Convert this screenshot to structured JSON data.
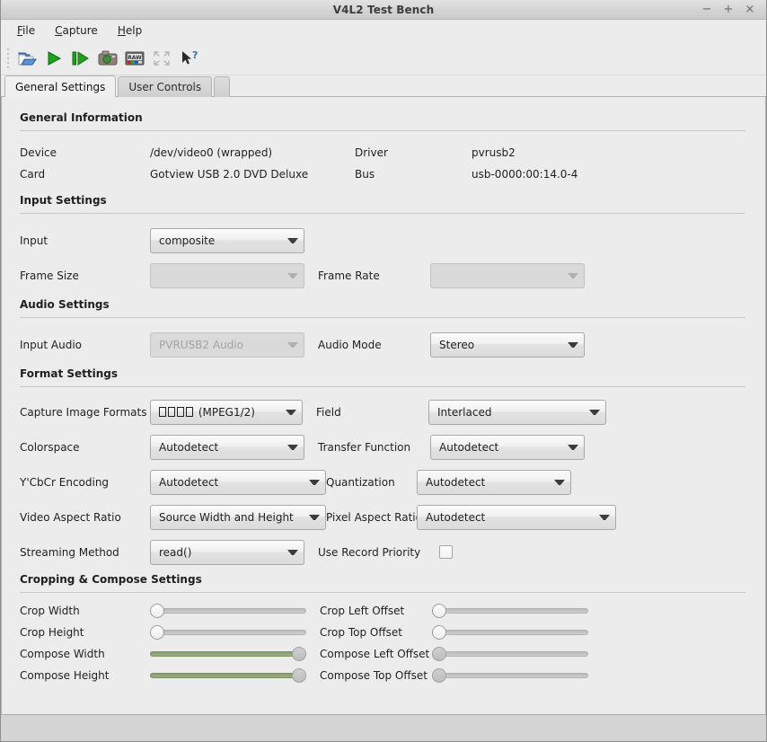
{
  "window": {
    "title": "V4L2 Test Bench",
    "buttons": {
      "minimize": "−",
      "maximize": "+",
      "close": "×"
    }
  },
  "menubar": {
    "items": [
      {
        "label": "File",
        "mnemonic": "F"
      },
      {
        "label": "Capture",
        "mnemonic": "C"
      },
      {
        "label": "Help",
        "mnemonic": "H"
      }
    ]
  },
  "toolbar": {
    "items": [
      {
        "name": "open-file-icon",
        "title": "Open"
      },
      {
        "name": "play-icon",
        "title": "Start Capture"
      },
      {
        "name": "play-step-icon",
        "title": "Step"
      },
      {
        "name": "snapshot-camera-icon",
        "title": "Snapshot"
      },
      {
        "name": "raw-capture-icon",
        "title": "Raw Capture"
      },
      {
        "name": "fullscreen-icon",
        "title": "Fullscreen"
      },
      {
        "name": "whats-this-help-icon",
        "title": "What's This?"
      }
    ]
  },
  "tabs": [
    {
      "label": "General Settings",
      "active": true
    },
    {
      "label": "User Controls",
      "active": false
    },
    {
      "label": "",
      "active": false
    }
  ],
  "sections": {
    "general_information": {
      "title": "General Information",
      "fields": [
        {
          "label": "Device",
          "value": "/dev/video0 (wrapped)",
          "label2": "Driver",
          "value2": "pvrusb2"
        },
        {
          "label": "Card",
          "value": "Gotview USB 2.0 DVD Deluxe",
          "label2": "Bus",
          "value2": "usb-0000:00:14.0-4"
        }
      ]
    },
    "input_settings": {
      "title": "Input Settings",
      "input": {
        "label": "Input",
        "value": "composite",
        "disabled": false
      },
      "frame_size": {
        "label": "Frame Size",
        "value": "",
        "disabled": true
      },
      "frame_rate": {
        "label": "Frame Rate",
        "value": "",
        "disabled": true
      }
    },
    "audio_settings": {
      "title": "Audio Settings",
      "input_audio": {
        "label": "Input Audio",
        "value": "PVRUSB2 Audio",
        "disabled": true
      },
      "audio_mode": {
        "label": "Audio Mode",
        "value": "Stereo",
        "disabled": false
      }
    },
    "format_settings": {
      "title": "Format Settings",
      "capture_image_formats": {
        "label": "Capture Image Formats",
        "value": "□□□□ (MPEG1/2)",
        "value_suffix": " (MPEG1/2)",
        "tofu_count": 4
      },
      "field": {
        "label": "Field",
        "value": "Interlaced"
      },
      "colorspace": {
        "label": "Colorspace",
        "value": "Autodetect"
      },
      "transfer_function": {
        "label": "Transfer Function",
        "value": "Autodetect"
      },
      "ycbcr_encoding": {
        "label": "Y'CbCr Encoding",
        "value": "Autodetect"
      },
      "quantization": {
        "label": "Quantization",
        "value": "Autodetect"
      },
      "video_aspect_ratio": {
        "label": "Video Aspect Ratio",
        "value": "Source Width and Height"
      },
      "pixel_aspect_ratio": {
        "label": "Pixel Aspect Ratio",
        "value": "Autodetect"
      },
      "streaming_method": {
        "label": "Streaming Method",
        "value": "read()"
      },
      "use_record_priority": {
        "label": "Use Record Priority",
        "checked": false
      }
    },
    "cropping_compose": {
      "title": "Cropping & Compose Settings",
      "sliders_left": [
        {
          "label": "Crop Width",
          "percent": 0,
          "filled": false,
          "enabled": true
        },
        {
          "label": "Crop Height",
          "percent": 0,
          "filled": false,
          "enabled": true
        },
        {
          "label": "Compose Width",
          "percent": 100,
          "filled": true,
          "enabled": false
        },
        {
          "label": "Compose Height",
          "percent": 100,
          "filled": true,
          "enabled": false
        }
      ],
      "sliders_right": [
        {
          "label": "Crop Left Offset",
          "percent": 0,
          "filled": false,
          "enabled": true
        },
        {
          "label": "Crop Top Offset",
          "percent": 0,
          "filled": false,
          "enabled": true
        },
        {
          "label": "Compose Left Offset",
          "percent": 0,
          "filled": false,
          "enabled": false
        },
        {
          "label": "Compose Top Offset",
          "percent": 0,
          "filled": false,
          "enabled": false
        }
      ]
    }
  },
  "colors": {
    "window_bg": "#ececec",
    "slider_green": "#8ea577",
    "accent_text": "#1f1f1f"
  }
}
